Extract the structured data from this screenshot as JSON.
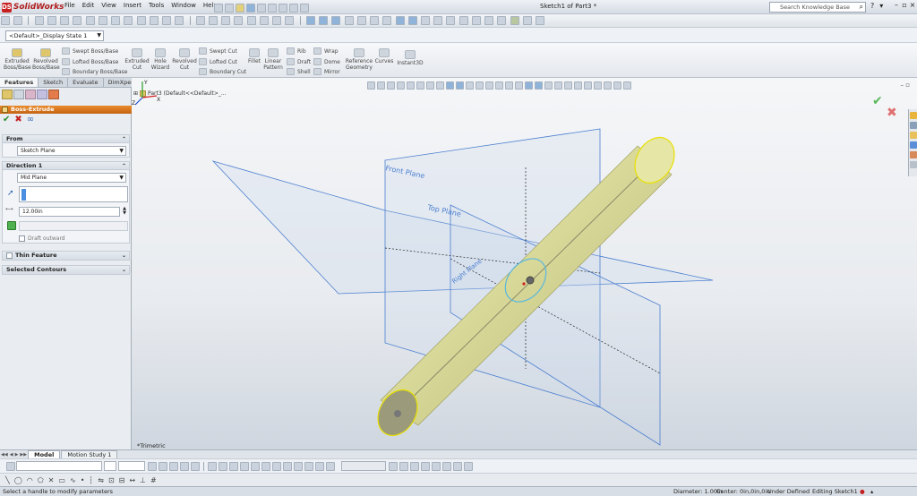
{
  "app": {
    "name": "SolidWorks",
    "logo_text": "DS"
  },
  "menu": [
    "File",
    "Edit",
    "View",
    "Insert",
    "Tools",
    "Window",
    "Help"
  ],
  "document_title": "Sketch1 of Part3 *",
  "search": {
    "placeholder": "Search Knowledge Base"
  },
  "help": {
    "question": "?",
    "dropdown": "▾"
  },
  "config": {
    "value": "<Default>_Display State 1"
  },
  "command_manager": {
    "extruded_boss": "Extruded\nBoss/Base",
    "revolved_boss": "Revolved\nBoss/Base",
    "swept_boss": "Swept Boss/Base",
    "lofted_boss": "Lofted Boss/Base",
    "boundary_boss": "Boundary Boss/Base",
    "extruded_cut": "Extruded\nCut",
    "hole_wizard": "Hole\nWizard",
    "revolved_cut": "Revolved\nCut",
    "swept_cut": "Swept Cut",
    "lofted_cut": "Lofted Cut",
    "boundary_cut": "Boundary Cut",
    "fillet": "Fillet",
    "linear_pattern": "Linear\nPattern",
    "rib": "Rib",
    "draft": "Draft",
    "shell": "Shell",
    "wrap": "Wrap",
    "dome": "Dome",
    "mirror": "Mirror",
    "reference_geometry": "Reference\nGeometry",
    "curves": "Curves",
    "instant3d": "Instant3D"
  },
  "panel_tabs": [
    "Features",
    "Sketch",
    "Evaluate",
    "DimXpert"
  ],
  "property_manager": {
    "title": "Boss-Extrude",
    "from": {
      "label": "From",
      "value": "Sketch Plane"
    },
    "direction1": {
      "label": "Direction 1",
      "end_condition": "Mid Plane",
      "depth": "12.00in",
      "draft_outward": "Draft outward"
    },
    "thin_feature": "Thin Feature",
    "selected_contours": "Selected Contours"
  },
  "graphics": {
    "tree_root": "Part3  (Default<<Default>_...",
    "view_label": "*Trimetric",
    "planes": {
      "front": "Front Plane",
      "top": "Top Plane",
      "right": "Right Plane"
    },
    "triad": {
      "x": "X",
      "y": "Y",
      "z": "Z"
    }
  },
  "bottom_tabs": [
    "Model",
    "Motion Study 1"
  ],
  "status": {
    "message": "Select a handle to modify parameters",
    "diameter": "Diameter: 1.00in",
    "center": "Center: 0in,0in,0in",
    "state": "Under Defined",
    "editing": "Editing Sketch1"
  },
  "colors": {
    "accent_orange": "#e07b20",
    "cylinder": "#d9d99a",
    "plane": "#4b7fd0",
    "ok_green": "#2a8b2a",
    "cancel_red": "#c42020"
  }
}
